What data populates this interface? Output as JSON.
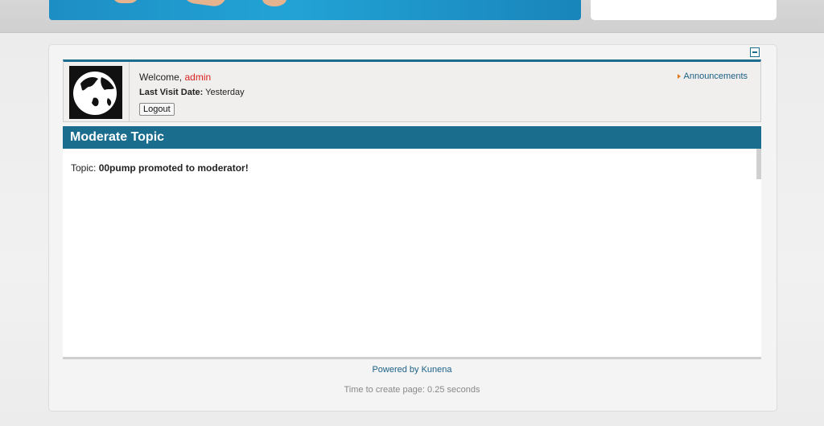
{
  "profile": {
    "welcome_prefix": "Welcome,",
    "username": "admin",
    "last_visit_label": "Last Visit Date:",
    "last_visit_value": "Yesterday",
    "logout_label": "Logout",
    "announcements_label": "Announcements"
  },
  "section": {
    "title": "Moderate Topic"
  },
  "topic": {
    "label": "Topic:",
    "title": "00pump promoted to moderator!"
  },
  "footer": {
    "powered_by": "Powered by Kunena",
    "time_to_create": "Time to create page: 0.25 seconds"
  },
  "colors": {
    "accent": "#1b6d8e",
    "username": "#d82020",
    "link": "#1c5f86"
  },
  "icons": {
    "collapse": "collapse-icon",
    "avatar": "globe-avatar",
    "announce_arrow": "arrow-right-icon"
  }
}
